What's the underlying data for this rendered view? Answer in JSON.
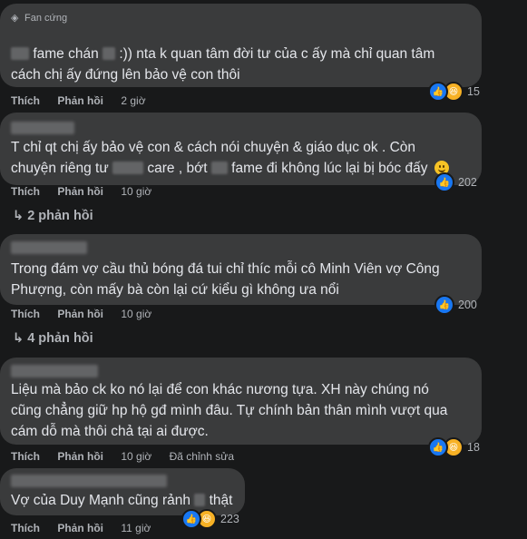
{
  "actions": {
    "like": "Thích",
    "reply": "Phản hồi"
  },
  "comments": [
    {
      "badge": "Fan cứng",
      "segments": [
        "fame chán",
        ":)) nta k quan tâm đời tư của c ấy mà chỉ quan tâm",
        "cách chị ấy đứng lên bảo vệ con thôi"
      ],
      "time": "2 giờ",
      "reaction_count": "15",
      "reactions": [
        "like",
        "haha"
      ]
    },
    {
      "segments": [
        "T chỉ qt chị ấy bảo vệ con & cách nói chuyện & giáo dục ok . Còn",
        "chuyện riêng tư",
        "care , bớt",
        "fame đi không lúc lại bị bóc đấy"
      ],
      "time": "10 giờ",
      "reaction_count": "202",
      "reactions": [
        "like"
      ],
      "replies": "2 phản hồi"
    },
    {
      "segments": [
        "Trong đám vợ cầu thủ bóng đá tui chỉ thíc mỗi cô Minh Viên vợ Công",
        "Phượng, còn mấy bà còn lại cứ kiểu gì không ưa nổi"
      ],
      "time": "10 giờ",
      "reaction_count": "200",
      "reactions": [
        "like"
      ],
      "replies": "4 phản hồi"
    },
    {
      "segments": [
        "Liệu mà bảo ck ko nó lại để con khác nương tựa. XH này chúng nó",
        "cũng chẳng giữ hp hộ gđ mình đâu. Tự chính bản thân mình vượt qua",
        "cám dỗ mà thôi chả tại ai được."
      ],
      "time": "10 giờ",
      "edited": "Đã chỉnh sửa",
      "reaction_count": "18",
      "reactions": [
        "like",
        "haha"
      ]
    },
    {
      "segments": [
        "Vợ của Duy Mạnh cũng rảnh",
        "thật"
      ],
      "time": "11 giờ",
      "reaction_count": "223",
      "reactions": [
        "like",
        "haha"
      ]
    }
  ]
}
